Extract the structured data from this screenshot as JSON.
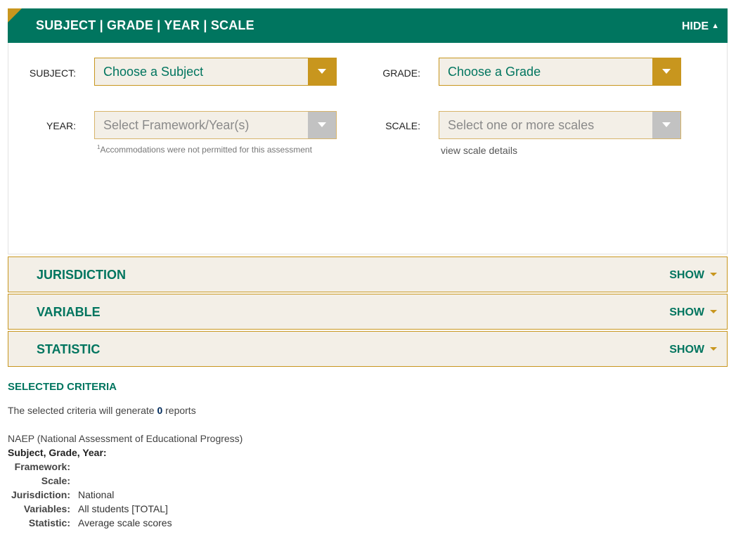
{
  "header": {
    "title": "SUBJECT | GRADE | YEAR | SCALE",
    "toggle": "HIDE",
    "toggle_icon": "▲"
  },
  "fields": {
    "subject": {
      "label": "SUBJECT:",
      "value": "Choose a Subject"
    },
    "grade": {
      "label": "GRADE:",
      "value": "Choose a Grade"
    },
    "year": {
      "label": "YEAR:",
      "value": "Select Framework/Year(s)"
    },
    "scale": {
      "label": "SCALE:",
      "value": "Select one or more scales"
    }
  },
  "year_note": {
    "sup": "1",
    "text": "Accommodations were not permitted for this assessment"
  },
  "scale_link": "view scale details",
  "sections": [
    {
      "title": "JURISDICTION",
      "toggle": "SHOW"
    },
    {
      "title": "VARIABLE",
      "toggle": "SHOW"
    },
    {
      "title": "STATISTIC",
      "toggle": "SHOW"
    }
  ],
  "criteria": {
    "title": "SELECTED CRITERIA",
    "summary_prefix": "The selected criteria will generate",
    "count": "0",
    "summary_suffix": "reports",
    "assessment": "NAEP (National Assessment of Educational Progress)",
    "sgy_label": "Subject, Grade, Year:",
    "rows": [
      {
        "key": "Framework:",
        "value": ""
      },
      {
        "key": "Scale:",
        "value": ""
      },
      {
        "key": "Jurisdiction:",
        "value": "National"
      },
      {
        "key": "Variables:",
        "value": "All students [TOTAL]"
      },
      {
        "key": "Statistic:",
        "value": "Average scale scores"
      }
    ]
  },
  "colors": {
    "brand_green": "#00755f",
    "gold": "#c8961e",
    "panel_bg": "#f3efe7"
  }
}
